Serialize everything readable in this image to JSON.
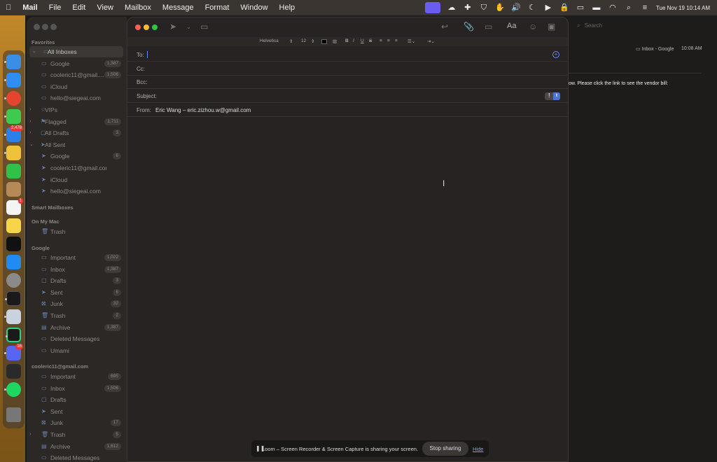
{
  "menubar": {
    "app": "Mail",
    "items": [
      "File",
      "Edit",
      "View",
      "Mailbox",
      "Message",
      "Format",
      "Window",
      "Help"
    ],
    "datetime": "Tue Nov 19  10:14 AM"
  },
  "sidebar": {
    "favorites_header": "Favorites",
    "favorites": [
      {
        "label": "All Inboxes",
        "count": "",
        "selected": true,
        "level": 0,
        "chev": "⌄",
        "icon": "inbox-icon"
      },
      {
        "label": "Google",
        "count": "1,387",
        "level": 1,
        "icon": "inbox-icon"
      },
      {
        "label": "cooleric11@gmail....",
        "count": "1,506",
        "level": 1,
        "icon": "inbox-icon"
      },
      {
        "label": "iCloud",
        "count": "",
        "level": 1,
        "icon": "inbox-icon"
      },
      {
        "label": "hello@siegeai.com",
        "count": "",
        "level": 1,
        "icon": "inbox-icon"
      },
      {
        "label": "VIPs",
        "count": "",
        "level": 0,
        "chev": "›",
        "icon": "star-icon"
      },
      {
        "label": "Flagged",
        "count": "1,711",
        "level": 0,
        "chev": "›",
        "icon": "flag-icon"
      },
      {
        "label": "All Drafts",
        "count": "3",
        "level": 0,
        "chev": "›",
        "icon": "draft-icon"
      },
      {
        "label": "All Sent",
        "count": "",
        "level": 0,
        "chev": "⌄",
        "icon": "sent-icon"
      },
      {
        "label": "Google",
        "count": "6",
        "level": 1,
        "icon": "sent-icon"
      },
      {
        "label": "cooleric11@gmail.com",
        "count": "",
        "level": 1,
        "icon": "sent-icon"
      },
      {
        "label": "iCloud",
        "count": "",
        "level": 1,
        "icon": "sent-icon"
      },
      {
        "label": "hello@siegeai.com",
        "count": "",
        "level": 1,
        "icon": "sent-icon"
      }
    ],
    "smart_header": "Smart Mailboxes",
    "onmymac_header": "On My Mac",
    "onmymac": [
      {
        "label": "Trash",
        "count": "",
        "icon": "trash-icon"
      }
    ],
    "google_header": "Google",
    "google": [
      {
        "label": "Important",
        "count": "1,022",
        "icon": "folder-icon"
      },
      {
        "label": "Inbox",
        "count": "1,387",
        "icon": "inbox-icon"
      },
      {
        "label": "Drafts",
        "count": "3",
        "icon": "draft-icon"
      },
      {
        "label": "Sent",
        "count": "6",
        "icon": "sent-icon"
      },
      {
        "label": "Junk",
        "count": "32",
        "icon": "junk-icon"
      },
      {
        "label": "Trash",
        "count": "2",
        "icon": "trash-icon"
      },
      {
        "label": "Archive",
        "count": "1,387",
        "icon": "archive-icon"
      },
      {
        "label": "Deleted Messages",
        "count": "",
        "icon": "folder-icon"
      },
      {
        "label": "Umami",
        "count": "",
        "icon": "folder-icon"
      }
    ],
    "cool_header": "cooleric11@gmail.com",
    "cool": [
      {
        "label": "Important",
        "count": "695",
        "icon": "folder-icon"
      },
      {
        "label": "Inbox",
        "count": "1,506",
        "icon": "inbox-icon"
      },
      {
        "label": "Drafts",
        "count": "",
        "icon": "draft-icon"
      },
      {
        "label": "Sent",
        "count": "",
        "icon": "sent-icon"
      },
      {
        "label": "Junk",
        "count": "17",
        "icon": "junk-icon"
      },
      {
        "label": "Trash",
        "count": "5",
        "icon": "trash-icon",
        "chev": "›"
      },
      {
        "label": "Archive",
        "count": "1,612",
        "icon": "archive-icon"
      },
      {
        "label": "Deleted Messages",
        "count": "",
        "icon": "folder-icon"
      }
    ]
  },
  "viewer": {
    "search_placeholder": "Search",
    "inbox_label": "Inbox - Google",
    "time": "10:08 AM",
    "snippet": "ow. Please click the link to see the vendor bill:"
  },
  "compose": {
    "format": {
      "font": "Helvetica",
      "size": "12"
    },
    "to_label": "To:",
    "cc_label": "Cc:",
    "bcc_label": "Bcc:",
    "subject_label": "Subject:",
    "from_label": "From:",
    "from_value": "Eric Wang – eric.zizhou.w@gmail.com",
    "priority": "!"
  },
  "loom": {
    "message": "Loom – Screen Recorder & Screen Capture is sharing your screen.",
    "stop_label": "Stop sharing",
    "hide_label": "Hide"
  },
  "dock_icons": [
    "finder-icon",
    "safari-icon",
    "chrome-icon",
    "messages-icon",
    "mail-icon",
    "photos-icon",
    "facetime-icon",
    "notes-app-icon",
    "reminders-icon",
    "notes-icon",
    "apple-tv-icon",
    "app-store-icon",
    "settings-icon",
    "terminal-icon",
    "preview-icon",
    "pycharm-icon",
    "discord-icon",
    "editor-icon",
    "spotify-icon",
    "trash-icon"
  ],
  "dock_badges": {
    "mail-icon": "2,478",
    "reminders-icon": "1",
    "discord-icon": "16"
  },
  "colors": {
    "accent": "#5a8bff",
    "loom": "#6b5cf0"
  }
}
